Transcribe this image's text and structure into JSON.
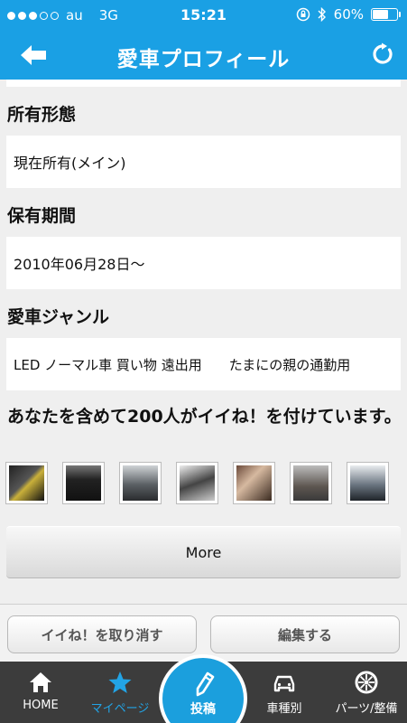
{
  "status": {
    "carrier": "au",
    "network": "3G",
    "time": "15:21",
    "battery": "60%",
    "battery_level": 0.6
  },
  "nav": {
    "title": "愛車プロフィール"
  },
  "sections": [
    {
      "title": "所有形態",
      "value": "現在所有(メイン)"
    },
    {
      "title": "保有期間",
      "value": "2010年06月28日〜"
    },
    {
      "title": "愛車ジャンル",
      "value": "LED ノーマル車 買い物 遠出用　　たまにの親の通勤用"
    }
  ],
  "likes": {
    "text": "あなたを含めて200人がイイね！を付けています。"
  },
  "more": {
    "label": "More"
  },
  "actions": {
    "unlike_label": "イイね！を取り消す",
    "edit_label": "編集する"
  },
  "tabs": {
    "home": "HOME",
    "mypage": "マイページ",
    "post": "投稿",
    "cars": "車種別",
    "parts": "パーツ/整備"
  },
  "colors": {
    "accent": "#1aa0e4",
    "tabbar": "#3c3c3c",
    "active_tab": "#22a4e6"
  },
  "icons": [
    "back-arrow-icon",
    "refresh-icon",
    "home-icon",
    "star-icon",
    "pencil-icon",
    "car-icon",
    "wheel-icon"
  ]
}
